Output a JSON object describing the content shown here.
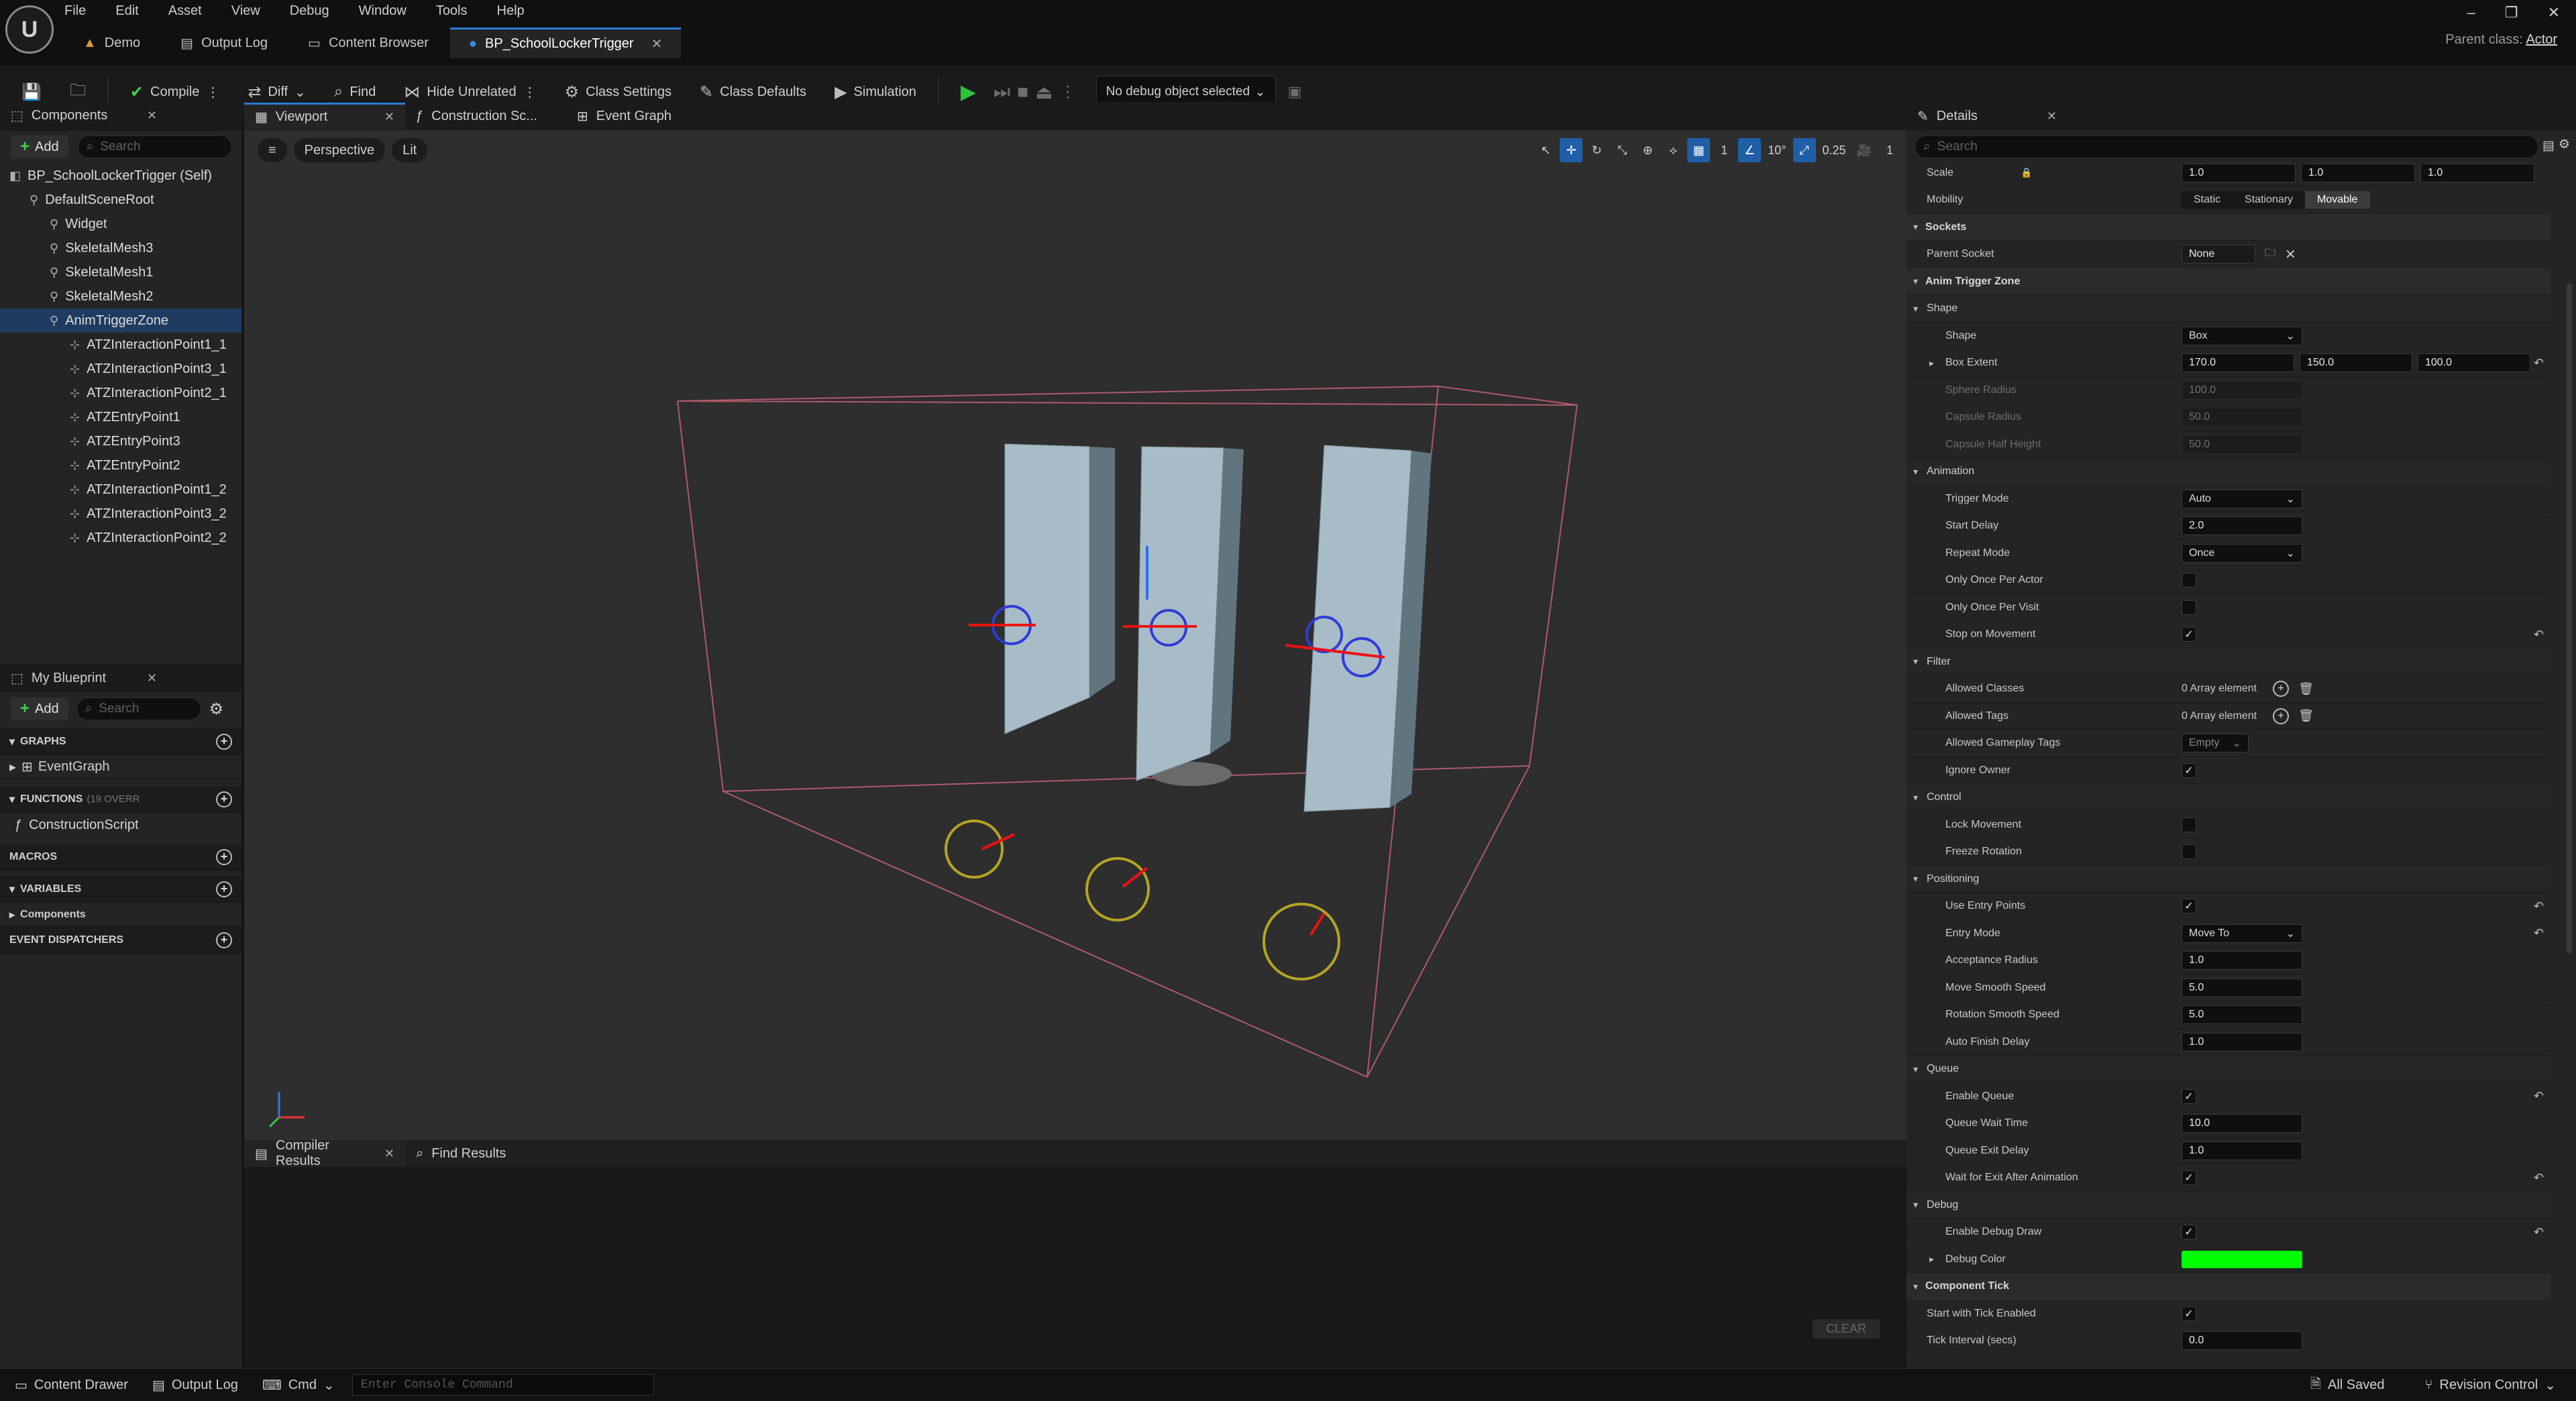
{
  "menu": [
    "File",
    "Edit",
    "Asset",
    "View",
    "Debug",
    "Window",
    "Tools",
    "Help"
  ],
  "doc_tabs": [
    {
      "label": "Demo"
    },
    {
      "label": "Output Log"
    },
    {
      "label": "Content Browser"
    },
    {
      "label": "BP_SchoolLockerTrigger"
    }
  ],
  "parent_class": {
    "label": "Parent class:",
    "value": "Actor"
  },
  "toolbar": {
    "compile": "Compile",
    "diff": "Diff",
    "find": "Find",
    "hide_unrelated": "Hide Unrelated",
    "class_settings": "Class Settings",
    "class_defaults": "Class Defaults",
    "simulation": "Simulation",
    "debug_object": "No debug object selected"
  },
  "components": {
    "title": "Components",
    "add": "Add",
    "search_placeholder": "Search",
    "tree": [
      {
        "label": "BP_SchoolLockerTrigger (Self)",
        "indent": 0
      },
      {
        "label": "DefaultSceneRoot",
        "indent": 1
      },
      {
        "label": "Widget",
        "indent": 2
      },
      {
        "label": "SkeletalMesh3",
        "indent": 2
      },
      {
        "label": "SkeletalMesh1",
        "indent": 2
      },
      {
        "label": "SkeletalMesh2",
        "indent": 2
      },
      {
        "label": "AnimTriggerZone",
        "indent": 2
      },
      {
        "label": "ATZInteractionPoint1_1",
        "indent": 3
      },
      {
        "label": "ATZInteractionPoint3_1",
        "indent": 3
      },
      {
        "label": "ATZInteractionPoint2_1",
        "indent": 3
      },
      {
        "label": "ATZEntryPoint1",
        "indent": 3
      },
      {
        "label": "ATZEntryPoint3",
        "indent": 3
      },
      {
        "label": "ATZEntryPoint2",
        "indent": 3
      },
      {
        "label": "ATZInteractionPoint1_2",
        "indent": 3
      },
      {
        "label": "ATZInteractionPoint3_2",
        "indent": 3
      },
      {
        "label": "ATZInteractionPoint2_2",
        "indent": 3
      }
    ],
    "selected": "AnimTriggerZone"
  },
  "my_blueprint": {
    "title": "My Blueprint",
    "add": "Add",
    "search_placeholder": "Search",
    "graphs": "GRAPHS",
    "event_graph": "EventGraph",
    "functions": "FUNCTIONS",
    "functions_sub": "(19 OVERR",
    "construction_script": "ConstructionScript",
    "macros": "MACROS",
    "variables": "VARIABLES",
    "components": "Components",
    "event_dispatchers": "EVENT DISPATCHERS"
  },
  "center_tabs": [
    "Viewport",
    "Construction Sc...",
    "Event Graph"
  ],
  "viewport": {
    "perspective": "Perspective",
    "lit": "Lit",
    "grid": "1",
    "angle": "10°",
    "scale": "0.25",
    "camera": "1"
  },
  "bottom_tabs": [
    "Compiler Results",
    "Find Results"
  ],
  "clear": "CLEAR",
  "details": {
    "title": "Details",
    "search_placeholder": "Search",
    "scale": {
      "label": "Scale",
      "x": "1.0",
      "y": "1.0",
      "z": "1.0"
    },
    "mobility": {
      "label": "Mobility",
      "options": [
        "Static",
        "Stationary",
        "Movable"
      ],
      "selected": "Movable"
    },
    "sockets": "Sockets",
    "parent_socket": {
      "label": "Parent Socket",
      "value": "None"
    },
    "atz": "Anim Trigger Zone",
    "shape_group": "Shape",
    "shape": {
      "label": "Shape",
      "value": "Box"
    },
    "box_extent": {
      "label": "Box Extent",
      "x": "170.0",
      "y": "150.0",
      "z": "100.0"
    },
    "sphere_radius": {
      "label": "Sphere Radius",
      "value": "100.0"
    },
    "capsule_radius": {
      "label": "Capsule Radius",
      "value": "50.0"
    },
    "capsule_half": {
      "label": "Capsule Half Height",
      "value": "50.0"
    },
    "animation_group": "Animation",
    "trigger_mode": {
      "label": "Trigger Mode",
      "value": "Auto"
    },
    "start_delay": {
      "label": "Start Delay",
      "value": "2.0"
    },
    "repeat_mode": {
      "label": "Repeat Mode",
      "value": "Once"
    },
    "only_once_actor": {
      "label": "Only Once Per Actor",
      "checked": false
    },
    "only_once_visit": {
      "label": "Only Once Per Visit",
      "checked": false
    },
    "stop_movement": {
      "label": "Stop on Movement",
      "checked": true
    },
    "filter_group": "Filter",
    "allowed_classes": {
      "label": "Allowed Classes",
      "value": "0 Array element"
    },
    "allowed_tags": {
      "label": "Allowed Tags",
      "value": "0 Array element"
    },
    "allowed_gameplay_tags": {
      "label": "Allowed Gameplay Tags",
      "value": "Empty"
    },
    "ignore_owner": {
      "label": "Ignore Owner",
      "checked": true
    },
    "control_group": "Control",
    "lock_movement": {
      "label": "Lock Movement",
      "checked": false
    },
    "freeze_rotation": {
      "label": "Freeze Rotation",
      "checked": false
    },
    "positioning_group": "Positioning",
    "use_entry_points": {
      "label": "Use Entry Points",
      "checked": true
    },
    "entry_mode": {
      "label": "Entry Mode",
      "value": "Move To"
    },
    "acceptance_radius": {
      "label": "Acceptance Radius",
      "value": "1.0"
    },
    "move_smooth": {
      "label": "Move Smooth Speed",
      "value": "5.0"
    },
    "rotation_smooth": {
      "label": "Rotation Smooth Speed",
      "value": "5.0"
    },
    "auto_finish": {
      "label": "Auto Finish Delay",
      "value": "1.0"
    },
    "queue_group": "Queue",
    "enable_queue": {
      "label": "Enable Queue",
      "checked": true
    },
    "queue_wait": {
      "label": "Queue Wait Time",
      "value": "10.0"
    },
    "queue_exit": {
      "label": "Queue Exit Delay",
      "value": "1.0"
    },
    "wait_exit": {
      "label": "Wait for Exit After Animation",
      "checked": true
    },
    "debug_group": "Debug",
    "enable_debug_draw": {
      "label": "Enable Debug Draw",
      "checked": true
    },
    "debug_color": {
      "label": "Debug Color",
      "color": "#00ff00"
    },
    "component_tick": "Component Tick",
    "start_tick": {
      "label": "Start with Tick Enabled",
      "checked": true
    },
    "tick_interval": {
      "label": "Tick Interval (secs)",
      "value": "0.0"
    }
  },
  "statusbar": {
    "content_drawer": "Content Drawer",
    "output_log": "Output Log",
    "cmd": "Cmd",
    "console_placeholder": "Enter Console Command",
    "saved": "All Saved",
    "revision": "Revision Control"
  },
  "colors": {
    "accent": "#2a7bd8",
    "selection": "#1f3b5f",
    "play": "#29c43a",
    "debug_color": "#00ff00"
  }
}
